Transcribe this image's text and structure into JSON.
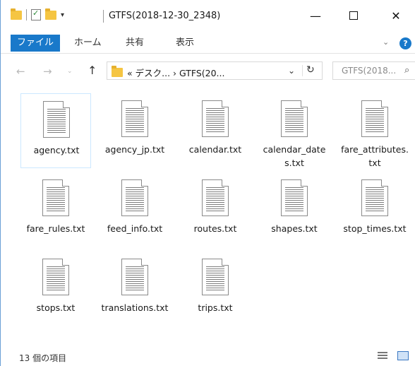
{
  "window": {
    "title": "GTFS(2018-12-30_2348)",
    "minimize_icon": "minimize-icon",
    "maximize_icon": "maximize-icon",
    "close_icon": "close-icon",
    "minimize_glyph": "—",
    "close_glyph": "✕"
  },
  "quick_access": {
    "drop_glyph": "▾"
  },
  "ribbon": {
    "tabs": [
      {
        "label": "ファイル",
        "active": true
      },
      {
        "label": "ホーム"
      },
      {
        "label": "共有"
      },
      {
        "label": "表示"
      }
    ],
    "expand_glyph": "⌄",
    "help_glyph": "?",
    "accent_color": "#1979ca"
  },
  "nav": {
    "back_glyph": "←",
    "forward_glyph": "→",
    "recent_glyph": "⌄",
    "up_glyph": "↑",
    "address": "« デスク...  ›  GTFS(20...",
    "address_drop_glyph": "⌄",
    "refresh_glyph": "↻",
    "search_placeholder": "GTFS(2018...",
    "search_glyph": "⌕"
  },
  "files": [
    {
      "label": "agency.txt",
      "selected": true
    },
    {
      "label": "agency_jp.txt"
    },
    {
      "label": "calendar.txt"
    },
    {
      "label": "calendar_dates.txt"
    },
    {
      "label": "fare_attributes.txt"
    },
    {
      "label": "fare_rules.txt"
    },
    {
      "label": "feed_info.txt"
    },
    {
      "label": "routes.txt"
    },
    {
      "label": "shapes.txt"
    },
    {
      "label": "stop_times.txt"
    },
    {
      "label": "stops.txt"
    },
    {
      "label": "translations.txt"
    },
    {
      "label": "trips.txt"
    }
  ],
  "status": {
    "count_text": "13 個の項目"
  }
}
